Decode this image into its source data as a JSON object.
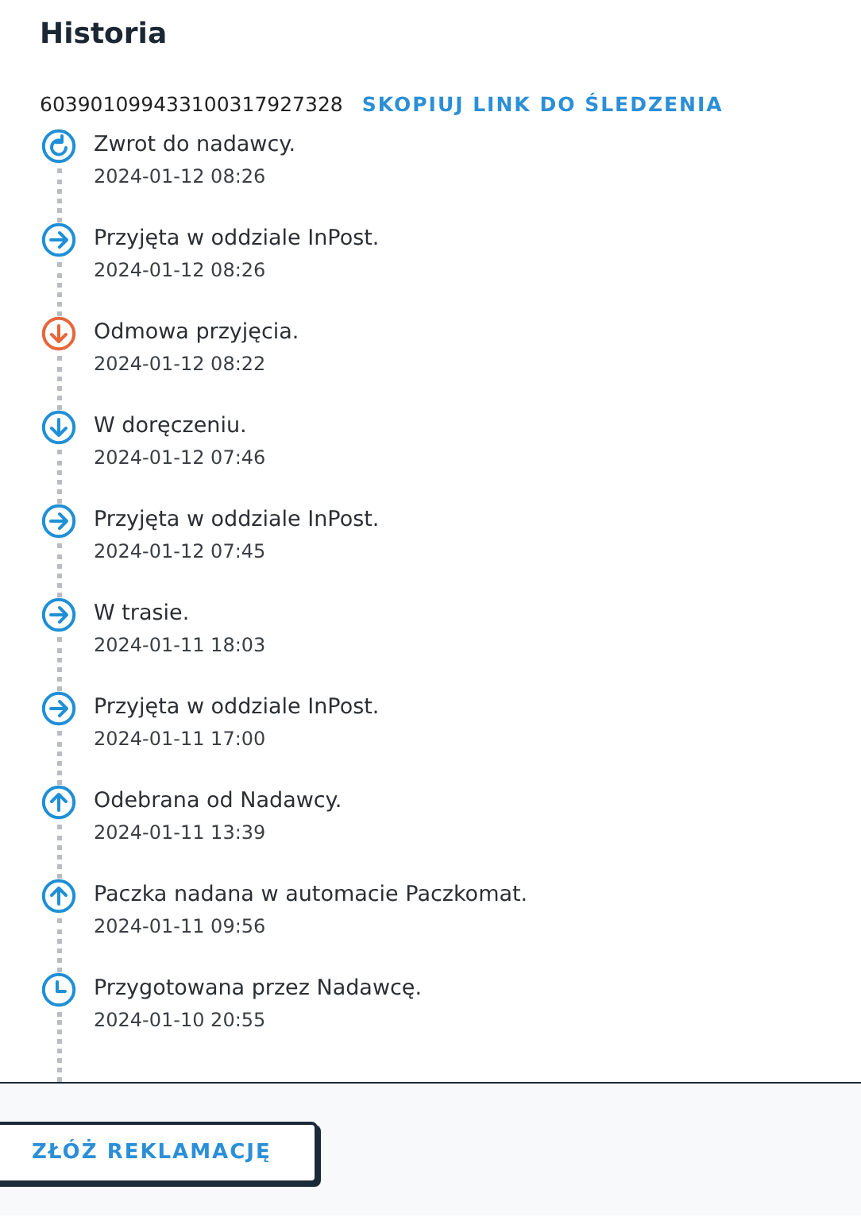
{
  "title": "Historia",
  "tracking_number": "603901099433100317927328",
  "copy_link": "SKOPIUJ LINK DO ŚLEDZENIA",
  "events": [
    {
      "kind": "return",
      "color": "#1f8fd6",
      "status": "Zwrot do nadawcy.",
      "time": "2024-01-12 08:26"
    },
    {
      "kind": "right",
      "color": "#1f8fd6",
      "status": "Przyjęta w oddziale InPost.",
      "time": "2024-01-12 08:26"
    },
    {
      "kind": "down",
      "color": "#e8653a",
      "status": "Odmowa przyjęcia.",
      "time": "2024-01-12 08:22"
    },
    {
      "kind": "down",
      "color": "#1f8fd6",
      "status": "W doręczeniu.",
      "time": "2024-01-12 07:46"
    },
    {
      "kind": "right",
      "color": "#1f8fd6",
      "status": "Przyjęta w oddziale InPost.",
      "time": "2024-01-12 07:45"
    },
    {
      "kind": "right",
      "color": "#1f8fd6",
      "status": "W trasie.",
      "time": "2024-01-11 18:03"
    },
    {
      "kind": "right",
      "color": "#1f8fd6",
      "status": "Przyjęta w oddziale InPost.",
      "time": "2024-01-11 17:00"
    },
    {
      "kind": "up",
      "color": "#1f8fd6",
      "status": "Odebrana od Nadawcy.",
      "time": "2024-01-11 13:39"
    },
    {
      "kind": "up",
      "color": "#1f8fd6",
      "status": "Paczka nadana w automacie Paczkomat.",
      "time": "2024-01-11 09:56"
    },
    {
      "kind": "clock",
      "color": "#1f8fd6",
      "status": "Przygotowana przez Nadawcę.",
      "time": "2024-01-10 20:55"
    }
  ],
  "complaint_button": "ZŁÓŻ REKLAMACJĘ"
}
